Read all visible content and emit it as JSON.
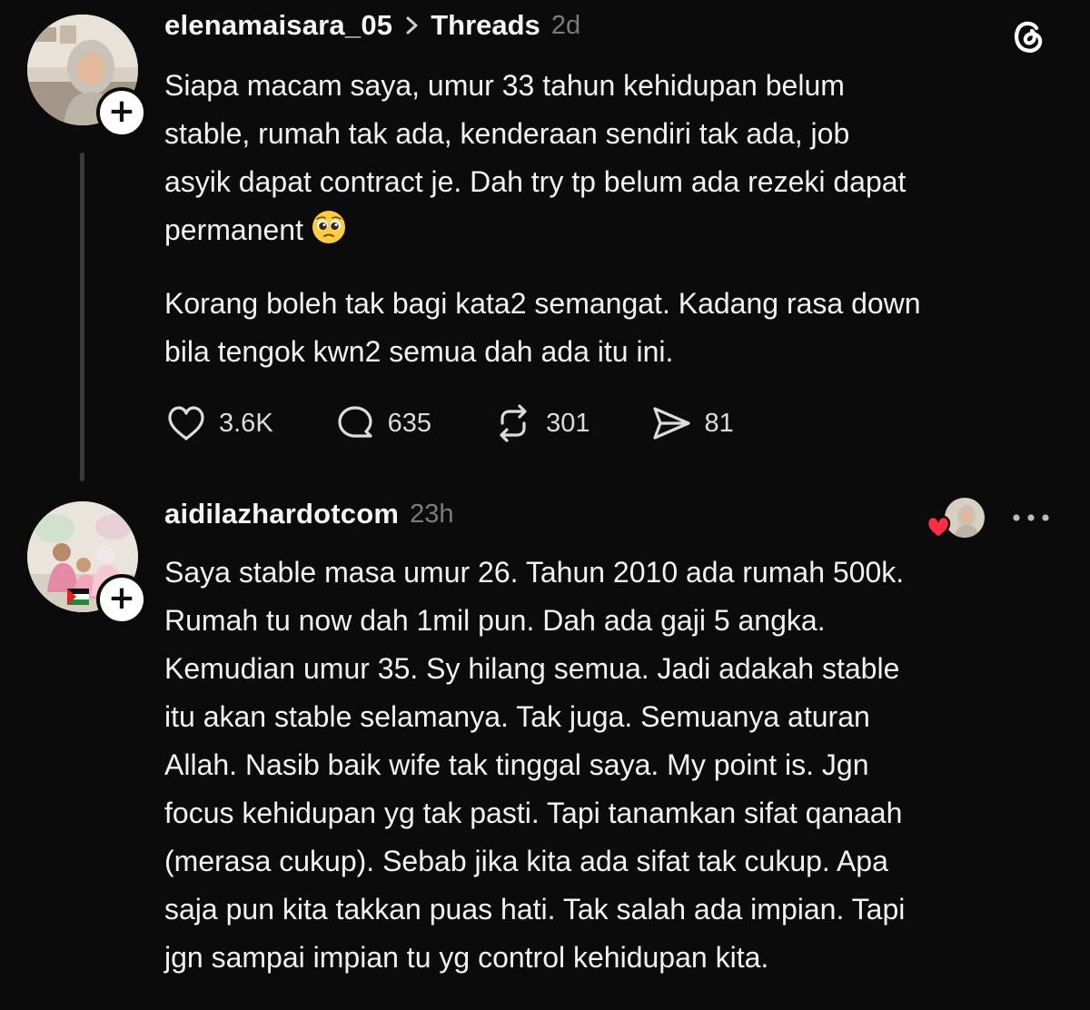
{
  "colors": {
    "background": "#0b0b0b",
    "text": "#f2f2f2",
    "muted": "#7b7b7b",
    "heart": "#ff2d46"
  },
  "post": {
    "username": "elenamaisara_05",
    "community": "Threads",
    "time": "2d",
    "text_p1": "Siapa macam saya, umur 33 tahun kehidupan belum\nstable, rumah tak ada, kenderaan sendiri tak ada, job\nasyik dapat contract je. Dah try tp belum ada rezeki dapat\npermanent",
    "emoji": "pleading-face",
    "text_p2": "Korang boleh tak bagi kata2 semangat. Kadang rasa down\nbila tengok kwn2 semua dah ada itu ini.",
    "stats": {
      "likes": "3.6K",
      "replies": "635",
      "reposts": "301",
      "shares": "81"
    },
    "follow_label": "+"
  },
  "reply": {
    "username": "aidilazhardotcom",
    "time": "23h",
    "text": "Saya stable masa umur 26. Tahun 2010 ada rumah 500k.\nRumah tu now dah 1mil pun. Dah ada gaji 5 angka.\nKemudian umur 35. Sy hilang semua. Jadi adakah stable\nitu akan stable selamanya. Tak juga. Semuanya aturan\nAllah. Nasib baik wife tak tinggal saya. My point is. Jgn\nfocus kehidupan yg tak pasti. Tapi tanamkan sifat qanaah\n(merasa cukup). Sebab jika kita ada sifat tak cukup. Apa\nsaja pun kita takkan puas hati. Tak salah ada impian. Tapi\njgn sampai impian tu yg control kehidupan kita.",
    "follow_label": "+"
  },
  "icons": [
    "threads-logo-icon",
    "chevron-right-icon",
    "heart-icon",
    "comment-icon",
    "repost-icon",
    "share-icon",
    "more-icon",
    "heart-badge-icon"
  ]
}
